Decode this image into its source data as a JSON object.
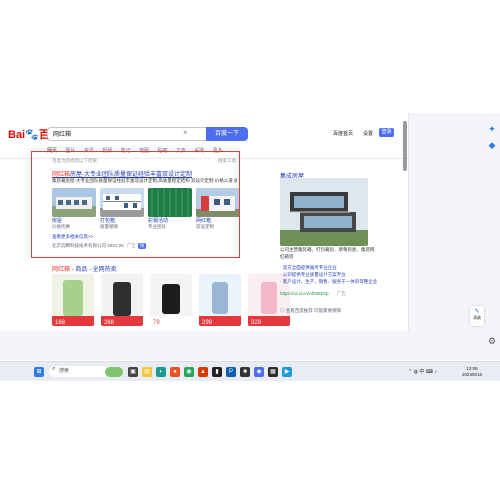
{
  "header": {
    "logo_text": "Bai",
    "logo_paw": "🐾",
    "logo_text2": "百度",
    "search_query": "网红箱",
    "search_button": "百度一下",
    "links": [
      "百度首页",
      "设置"
    ],
    "login": "登录"
  },
  "tabs": [
    "网页",
    "图片",
    "资讯",
    "视频",
    "笔记",
    "地图",
    "贴吧",
    "文库",
    "采购",
    "更多"
  ],
  "ad": {
    "hint": "百度为您找到以下结果",
    "hint_right": "搜索工具",
    "title_red": "网红箱",
    "title_rest": "房屋-大专业团队质量保证经验丰富双设计定制",
    "desc": "集装箱房屋-大专业团队质量保证经验丰富双设计定制,高质量稳定结构 双设计定制 价格公道 质量保证",
    "thumbs": [
      {
        "label": "房屋",
        "sub": "价格优惠"
      },
      {
        "label": "打包箱",
        "sub": "质量保障"
      },
      {
        "label": "彩钢活动",
        "sub": "专业团队"
      },
      {
        "label": "网红箱",
        "sub": "双设定制"
      }
    ],
    "more": "查看更多相关信息>>",
    "meta_company": "北京云腾科技技术有限公司 2024-06",
    "meta_ad": "广告",
    "meta_badge": "保"
  },
  "products": {
    "title_red": "网红箱",
    "title_rest": " - 商品 - 全网热卖",
    "price_tags": [
      "168",
      "268",
      "79",
      "299",
      "329"
    ]
  },
  "right_panel": {
    "title": "集成房屋",
    "desc": "公司主营集装箱、打包箱房、草莓房屋、集装网红箱等",
    "bullets": [
      "· 双方全面提供服务专业企业",
      "· 公司提供专业质量设计方案专业",
      "· 客户设计、生产、销售、服务于一体的等整企业"
    ],
    "url": "https://sc.d.cn/AfbW3Gp",
    "ad": "广告",
    "footer": "◎ 查看百度推荐 可能需要保障"
  },
  "taskbar": {
    "search": "搜索",
    "clock_time": "13:06",
    "clock_date": "2024/8/16",
    "tray": "⌃  ◍  中  ⌨  ♪"
  },
  "side_note": "清爽"
}
